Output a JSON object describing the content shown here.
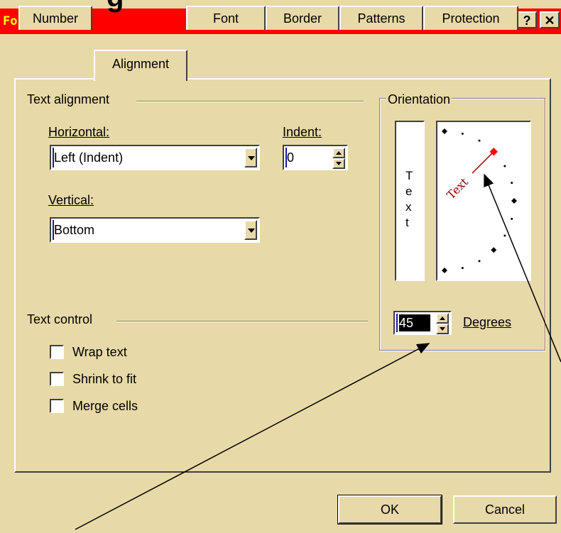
{
  "slide": {
    "title_fragment": "g"
  },
  "dialog": {
    "title": "Format Cells",
    "help_button": "?",
    "close_button": "✕"
  },
  "tabs": [
    {
      "label": "Number"
    },
    {
      "label": "Alignment"
    },
    {
      "label": "Font"
    },
    {
      "label": "Border"
    },
    {
      "label": "Patterns"
    },
    {
      "label": "Protection"
    }
  ],
  "text_alignment": {
    "group_label": "Text alignment",
    "horizontal_label": "Horizontal:",
    "horizontal_value": "Left (Indent)",
    "indent_label": "Indent:",
    "indent_value": "0",
    "vertical_label": "Vertical:",
    "vertical_value": "Bottom"
  },
  "orientation": {
    "group_label": "Orientation",
    "vertical_text": [
      "T",
      "e",
      "x",
      "t"
    ],
    "dial_text": "Text",
    "degrees_value": "45",
    "degrees_label": "Degrees",
    "angle_degrees": 45
  },
  "text_control": {
    "group_label": "Text control",
    "wrap_text": "Wrap text",
    "shrink_to_fit": "Shrink to fit",
    "merge_cells": "Merge cells"
  },
  "buttons": {
    "ok": "OK",
    "cancel": "Cancel"
  },
  "colors": {
    "title_bar": "#ff0000",
    "title_text": "#ffff00",
    "dialog_bg": "#e8d9a8",
    "dial_handle": "#ff0000"
  }
}
